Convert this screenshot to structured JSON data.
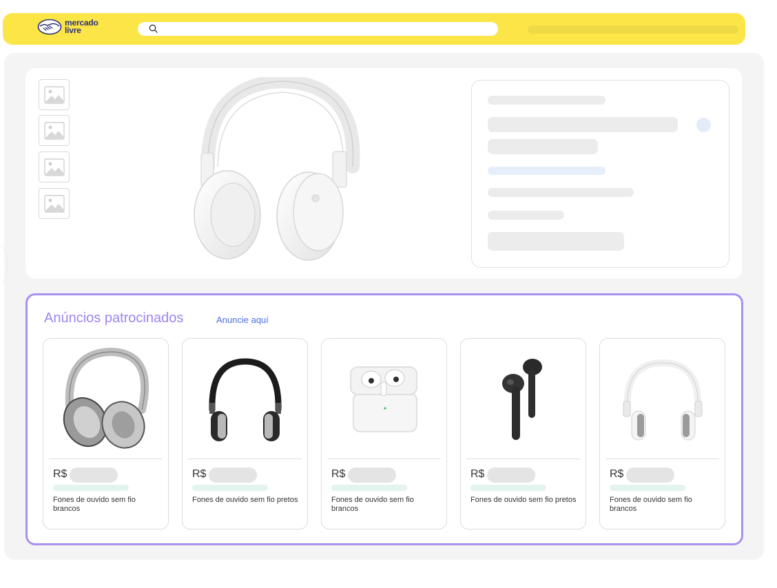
{
  "header": {
    "logo_line1": "mercado",
    "logo_line2": "livre",
    "search_icon": "search-icon"
  },
  "colors": {
    "header_bg": "#fce546",
    "brand_blue": "#2d3277",
    "sponsored_border": "#a890ef",
    "sponsored_title": "#9f84ee",
    "link": "#4a6ee0"
  },
  "sponsored": {
    "title": "Anúncios patrocinados",
    "link_label": "Anuncie aquí",
    "cards": [
      {
        "currency": "R$",
        "description": "Fones de ouvido sem fio brancos",
        "image": "silver-over-ear-headphones"
      },
      {
        "currency": "R$",
        "description": "Fones de ouvido sem fio pretos",
        "image": "black-over-ear-headphones"
      },
      {
        "currency": "R$",
        "description": "Fones de ouvido sem fio brancos",
        "image": "white-earbuds-case"
      },
      {
        "currency": "R$",
        "description": "Fones de ouvido sem fio pretos",
        "image": "black-earbuds"
      },
      {
        "currency": "R$",
        "description": "Fones de ouvido sem fio brancos",
        "image": "white-over-ear-headphones"
      }
    ]
  }
}
